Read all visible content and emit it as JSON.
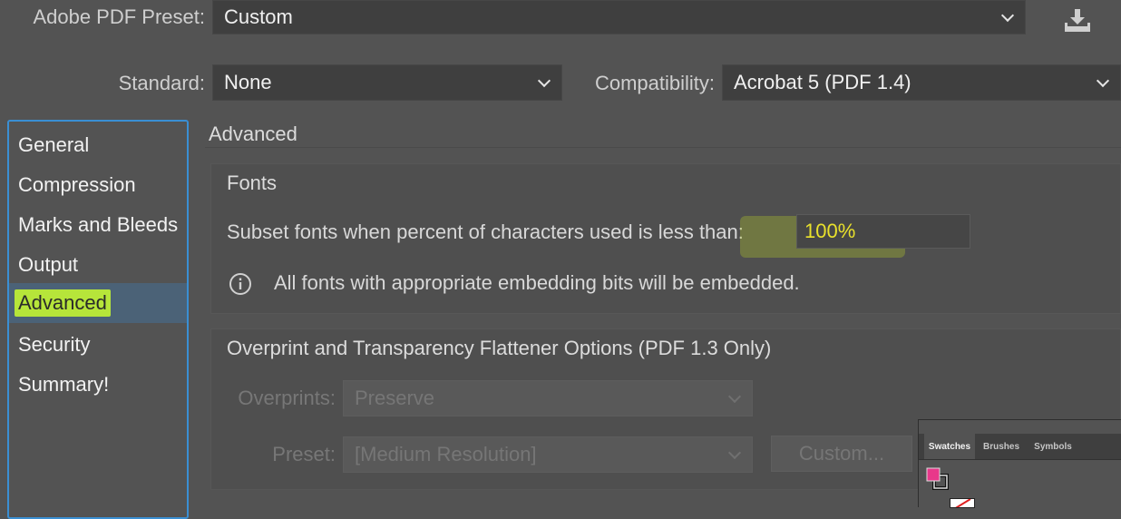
{
  "preset": {
    "label": "Adobe PDF Preset:",
    "value": "Custom"
  },
  "standard": {
    "label": "Standard:",
    "value": "None"
  },
  "compatibility": {
    "label": "Compatibility:",
    "value": "Acrobat 5 (PDF 1.4)"
  },
  "sidebar": {
    "items": [
      {
        "label": "General"
      },
      {
        "label": "Compression"
      },
      {
        "label": "Marks and Bleeds"
      },
      {
        "label": "Output"
      },
      {
        "label": "Advanced"
      },
      {
        "label": "Security"
      },
      {
        "label": "Summary!"
      }
    ],
    "selected": "Advanced"
  },
  "main": {
    "title": "Advanced",
    "fonts": {
      "title": "Fonts",
      "subset_label": "Subset fonts when percent of characters used is less than:",
      "subset_value": "100%",
      "info_text": "All fonts with appropriate embedding bits will be embedded."
    },
    "overprint": {
      "title": "Overprint and Transparency Flattener Options (PDF 1.3 Only)",
      "overprints_label": "Overprints:",
      "overprints_value": "Preserve",
      "preset_label": "Preset:",
      "preset_value": "[Medium Resolution]",
      "custom_button": "Custom..."
    }
  },
  "swatches_panel": {
    "tabs": [
      {
        "label": "Swatches"
      },
      {
        "label": "Brushes"
      },
      {
        "label": "Symbols"
      }
    ],
    "fill_color": "#e8388a"
  },
  "colors": {
    "background": "#535353",
    "accent_blue": "#3a8fd3",
    "highlight_green": "#b6e53a",
    "value_yellow": "#e9e12c"
  }
}
